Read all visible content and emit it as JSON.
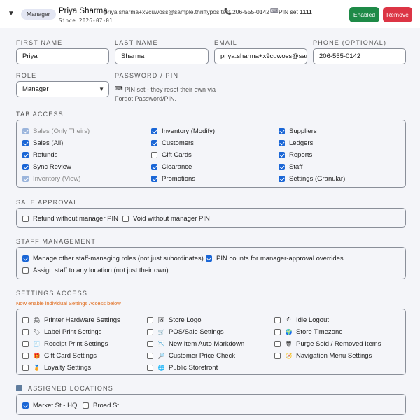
{
  "header": {
    "role_pill": "Manager",
    "name": "Priya Sharma",
    "email": "priya.sharma+x9cuwoss@sample.thriftypos.test",
    "phone": "206-555-0142",
    "pin_prefix": "PIN set",
    "pin_value": "1111",
    "since": "Since 2026-07-01",
    "enabled_label": "Enabled",
    "remove_label": "Remove",
    "colors": {
      "enabled": "#1e8a47",
      "remove": "#dc3545",
      "checkbox": "#1a66d6",
      "note": "#e06a1a"
    }
  },
  "form": {
    "first_name_label": "First Name",
    "first_name": "Priya",
    "last_name_label": "Last Name",
    "last_name": "Sharma",
    "email_label": "Email",
    "email": "priya.sharma+x9cuwoss@sam",
    "phone_label": "Phone (Optional)",
    "phone": "206-555-0142",
    "role_label": "Role",
    "role": "Manager",
    "password_label": "Password / PIN",
    "password_note": "PIN set - they reset their own via Forgot Password/PIN."
  },
  "tab_access": {
    "title": "Tab Access",
    "items": [
      {
        "label": "Sales (Only Theirs)",
        "checked": true,
        "dim": true
      },
      {
        "label": "Sales (All)",
        "checked": true
      },
      {
        "label": "Refunds",
        "checked": true
      },
      {
        "label": "Sync Review",
        "checked": true
      },
      {
        "label": "Inventory (View)",
        "checked": true,
        "dim": true
      },
      {
        "label": "Inventory (Modify)",
        "checked": true
      },
      {
        "label": "Customers",
        "checked": true
      },
      {
        "label": "Gift Cards",
        "checked": false
      },
      {
        "label": "Clearance",
        "checked": true
      },
      {
        "label": "Promotions",
        "checked": true
      },
      {
        "label": "Suppliers",
        "checked": true
      },
      {
        "label": "Ledgers",
        "checked": true
      },
      {
        "label": "Reports",
        "checked": true
      },
      {
        "label": "Staff",
        "checked": true
      },
      {
        "label": "Settings (Granular)",
        "checked": true
      }
    ]
  },
  "sale_approval": {
    "title": "Sale Approval",
    "items": [
      {
        "label": "Refund without manager PIN",
        "checked": false
      },
      {
        "label": "Void without manager PIN",
        "checked": false
      }
    ]
  },
  "staff_management": {
    "title": "Staff Management",
    "items": [
      {
        "label": "Manage other staff-managing roles (not just subordinates)",
        "checked": true
      },
      {
        "label": "PIN counts for manager-approval overrides",
        "checked": true
      },
      {
        "label": "Assign staff to any location (not just their own)",
        "checked": false
      }
    ]
  },
  "settings_access": {
    "title": "Settings Access",
    "note": "Now enable individual Settings Access below",
    "items": [
      {
        "label": "Printer Hardware Settings",
        "icon": "printer-icon",
        "glyph": "🖨",
        "checked": false
      },
      {
        "label": "Label Print Settings",
        "icon": "label-icon",
        "glyph": "🏷",
        "checked": false
      },
      {
        "label": "Receipt Print Settings",
        "icon": "receipt-icon",
        "glyph": "🧾",
        "checked": false
      },
      {
        "label": "Gift Card Settings",
        "icon": "gift-icon",
        "glyph": "🎁",
        "checked": false
      },
      {
        "label": "Loyalty Settings",
        "icon": "medal-icon",
        "glyph": "🏅",
        "checked": false
      },
      {
        "label": "Store Logo",
        "icon": "image-icon",
        "glyph": "🖼",
        "checked": false
      },
      {
        "label": "POS/Sale Settings",
        "icon": "cart-icon",
        "glyph": "🛒",
        "checked": false
      },
      {
        "label": "New Item Auto Markdown",
        "icon": "markdown-icon",
        "glyph": "📉",
        "checked": false
      },
      {
        "label": "Customer Price Check",
        "icon": "price-check-icon",
        "glyph": "🔎",
        "checked": false
      },
      {
        "label": "Public Storefront",
        "icon": "globe-icon",
        "glyph": "🌐",
        "checked": false
      },
      {
        "label": "Idle Logout",
        "icon": "stopwatch-icon",
        "glyph": "⏱",
        "checked": false
      },
      {
        "label": "Store Timezone",
        "icon": "globe-clock-icon",
        "glyph": "🌍",
        "checked": false
      },
      {
        "label": "Purge Sold / Removed Items",
        "icon": "trash-icon",
        "glyph": "🗑",
        "checked": false
      },
      {
        "label": "Navigation Menu Settings",
        "icon": "compass-icon",
        "glyph": "🧭",
        "checked": false
      }
    ]
  },
  "assigned_locations": {
    "title": "Assigned Locations",
    "items": [
      {
        "label": "Market St - HQ",
        "checked": true
      },
      {
        "label": "Broad St",
        "checked": false
      }
    ]
  }
}
